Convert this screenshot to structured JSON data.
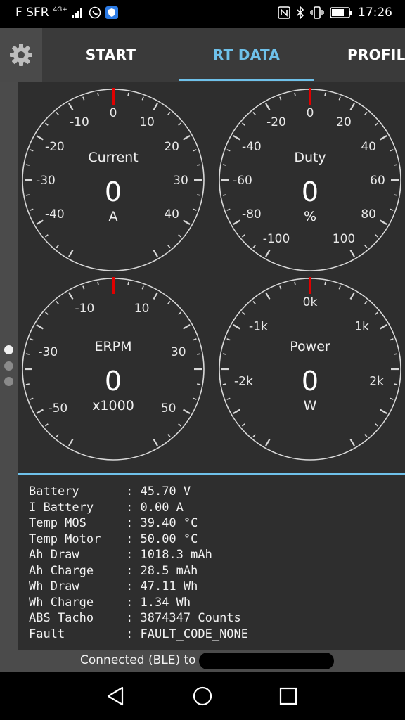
{
  "status_bar": {
    "carrier": "F SFR",
    "network": "4G+",
    "time": "17:26",
    "icons": [
      "signal-icon",
      "whatsapp-icon",
      "shield-app-icon",
      "nfc-icon",
      "bluetooth-icon",
      "vibrate-icon",
      "battery-icon"
    ]
  },
  "tabs": [
    {
      "label": "START"
    },
    {
      "label": "RT DATA"
    },
    {
      "label": "PROFILE"
    }
  ],
  "active_tab": "RT DATA",
  "colors": {
    "accent": "#6fc1ea",
    "needle": "#e00000",
    "panel": "#2e2e2e",
    "rail": "#4b4b4b"
  },
  "pager": {
    "pages": 3,
    "active": 1
  },
  "gauges": [
    {
      "name": "Current",
      "value": "0",
      "unit": "A",
      "min": -50,
      "max": 50,
      "current": 0,
      "tick_labels": [
        "-40",
        "-30",
        "-20",
        "-10",
        "0",
        "10",
        "20",
        "30",
        "40"
      ]
    },
    {
      "name": "Duty",
      "value": "0",
      "unit": "%",
      "min": -100,
      "max": 100,
      "current": 0,
      "tick_labels": [
        "-100",
        "-80",
        "-60",
        "-40",
        "-20",
        "0",
        "20",
        "40",
        "60",
        "80",
        "100"
      ]
    },
    {
      "name": "ERPM",
      "value": "0",
      "unit": "x1000",
      "min": -60,
      "max": 60,
      "current": 0,
      "tick_labels": [
        "-50",
        "-30",
        "-10",
        "10",
        "30",
        "50"
      ]
    },
    {
      "name": "Power",
      "value": "0",
      "unit": "W",
      "min": -3000,
      "max": 3000,
      "current": 0,
      "tick_labels": [
        "-2k",
        "-1k",
        "0k",
        "1k",
        "2k"
      ]
    }
  ],
  "rt_data": [
    {
      "label": "Battery",
      "value": "45.70 V"
    },
    {
      "label": "I Battery",
      "value": "0.00 A"
    },
    {
      "label": "Temp MOS",
      "value": "39.40 °C"
    },
    {
      "label": "Temp Motor",
      "value": "50.00 °C"
    },
    {
      "label": "Ah Draw",
      "value": "1018.3 mAh"
    },
    {
      "label": "Ah Charge",
      "value": "28.5 mAh"
    },
    {
      "label": "Wh Draw",
      "value": "47.11 Wh"
    },
    {
      "label": "Wh Charge",
      "value": "1.34 Wh"
    },
    {
      "label": "ABS Tacho",
      "value": "3874347 Counts"
    },
    {
      "label": "Fault",
      "value": "FAULT_CODE_NONE"
    }
  ],
  "footer": {
    "connection_text": "Connected (BLE) to"
  },
  "nav": {
    "back": "back-icon",
    "home": "home-icon",
    "recents": "recents-icon"
  }
}
